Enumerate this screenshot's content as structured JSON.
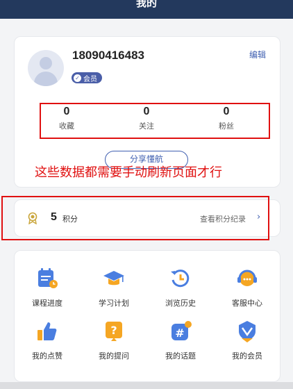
{
  "header": {
    "title": "我的"
  },
  "profile": {
    "phone": "18090416483",
    "badge": "会员",
    "edit_label": "编辑",
    "stats": [
      {
        "value": "0",
        "label": "收藏"
      },
      {
        "value": "0",
        "label": "关注"
      },
      {
        "value": "0",
        "label": "粉丝"
      }
    ],
    "share_label": "分享懂航"
  },
  "annotation": "这些数据都需要手动刷新页面才行",
  "points": {
    "value": "5",
    "label": "积分",
    "link": "查看积分纪录"
  },
  "grid": [
    {
      "label": "课程进度",
      "icon": "calendar-clock-icon"
    },
    {
      "label": "学习计划",
      "icon": "graduation-cap-icon"
    },
    {
      "label": "浏览历史",
      "icon": "history-icon"
    },
    {
      "label": "客服中心",
      "icon": "customer-service-icon"
    },
    {
      "label": "我的点赞",
      "icon": "thumbs-up-icon"
    },
    {
      "label": "我的提问",
      "icon": "question-icon"
    },
    {
      "label": "我的话题",
      "icon": "hashtag-icon"
    },
    {
      "label": "我的会员",
      "icon": "vip-shield-icon"
    }
  ],
  "colors": {
    "header": "#23395d",
    "accent": "#3f5fb0",
    "icon_blue": "#4a7ee0",
    "icon_orange": "#f5a623",
    "highlight": "#e01010"
  }
}
